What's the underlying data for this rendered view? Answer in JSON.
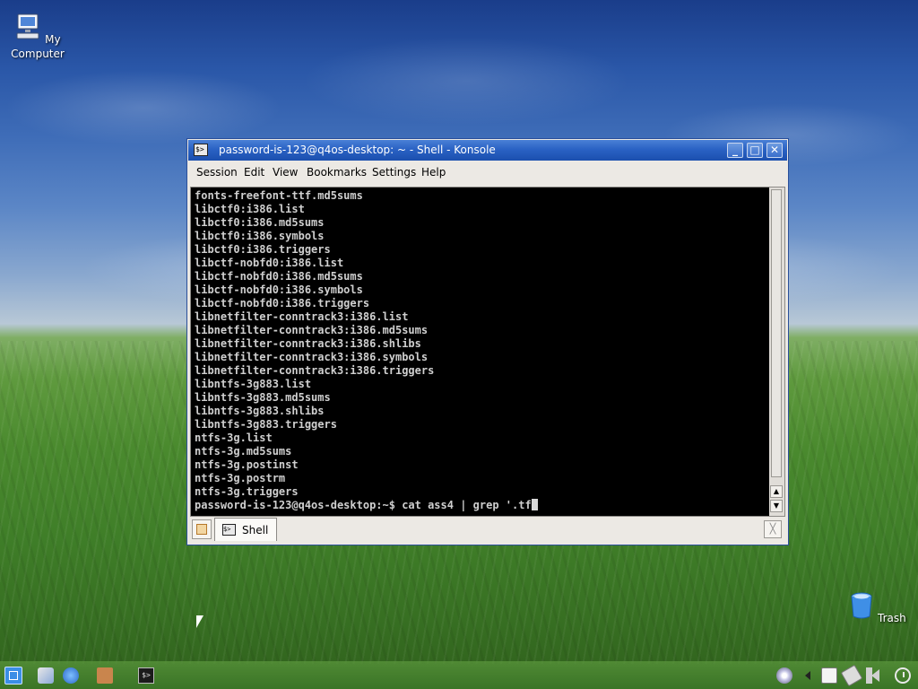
{
  "desktop": {
    "icons": [
      {
        "name": "my-computer",
        "label": "My\nComputer"
      },
      {
        "name": "trash",
        "label": "Trash"
      }
    ]
  },
  "window": {
    "title": "password-is-123@q4os-desktop: ~ - Shell - Konsole",
    "title_icon": "terminal-icon",
    "buttons": [
      "minimize-icon",
      "maximize-icon",
      "close-icon"
    ]
  },
  "menubar": {
    "items": [
      "Session",
      "Edit",
      "View",
      "Bookmarks",
      "Settings",
      "Help"
    ]
  },
  "terminal": {
    "lines": [
      "fonts-freefont-ttf.md5sums",
      "libctf0:i386.list",
      "libctf0:i386.md5sums",
      "libctf0:i386.symbols",
      "libctf0:i386.triggers",
      "libctf-nobfd0:i386.list",
      "libctf-nobfd0:i386.md5sums",
      "libctf-nobfd0:i386.symbols",
      "libctf-nobfd0:i386.triggers",
      "libnetfilter-conntrack3:i386.list",
      "libnetfilter-conntrack3:i386.md5sums",
      "libnetfilter-conntrack3:i386.shlibs",
      "libnetfilter-conntrack3:i386.symbols",
      "libnetfilter-conntrack3:i386.triggers",
      "libntfs-3g883.list",
      "libntfs-3g883.md5sums",
      "libntfs-3g883.shlibs",
      "libntfs-3g883.triggers",
      "ntfs-3g.list",
      "ntfs-3g.md5sums",
      "ntfs-3g.postinst",
      "ntfs-3g.postrm",
      "ntfs-3g.triggers"
    ],
    "prompt": "password-is-123@q4os-desktop:~$ ",
    "command": "cat ass4 | grep '.tf"
  },
  "tabs": [
    {
      "label": "Shell",
      "icon": "terminal-icon",
      "active": true
    }
  ],
  "tabbar": {
    "new_tab_icon": "new-tab-icon",
    "close_tab_icon": "close-tab-icon"
  },
  "taskbar": {
    "launchers": [
      "start-menu-icon",
      "settings-icon",
      "network-icon",
      "file-manager-icon",
      "konsole-icon"
    ],
    "tray": [
      "disc-icon",
      "tray-expand-icon",
      "clipboard-icon",
      "network-tray-icon",
      "volume-icon",
      "clock-icon"
    ]
  },
  "colors": {
    "titlebar": "#2a62c4",
    "terminal_bg": "#000000",
    "terminal_fg": "#cfcfcf",
    "window_bg": "#ece9e4"
  }
}
